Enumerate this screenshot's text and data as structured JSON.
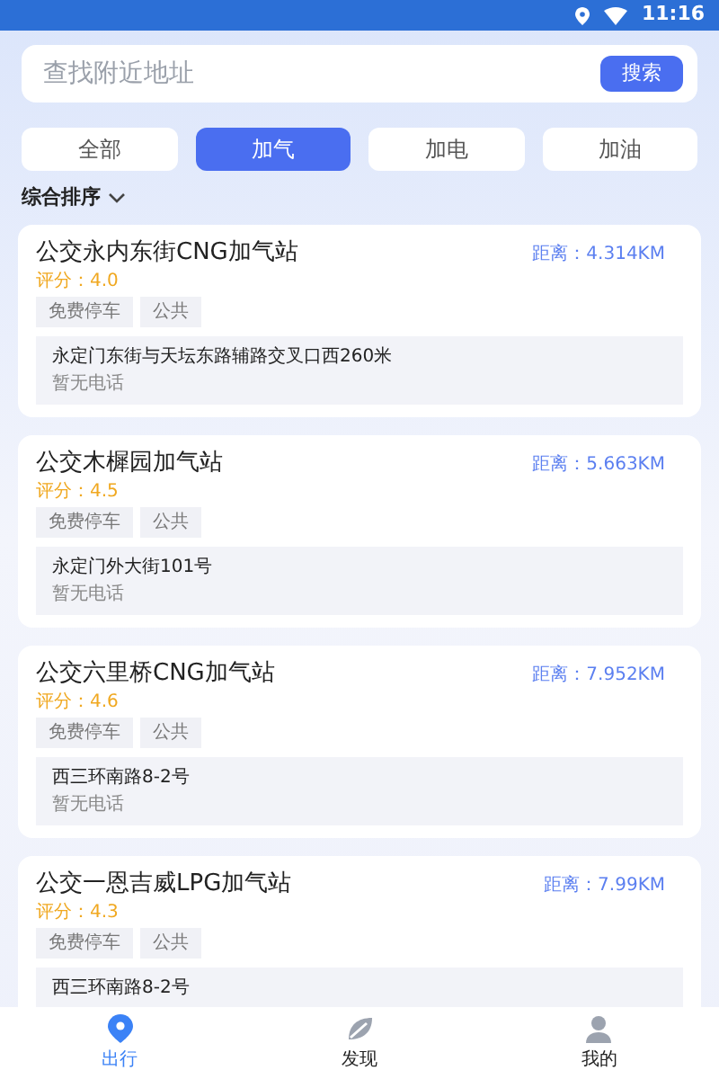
{
  "status_bar": {
    "time": "11:16"
  },
  "search": {
    "placeholder": "查找附近地址",
    "button": "搜索"
  },
  "tabs": [
    {
      "label": "全部",
      "selected": false
    },
    {
      "label": "加气",
      "selected": true
    },
    {
      "label": "加电",
      "selected": false
    },
    {
      "label": "加油",
      "selected": false
    }
  ],
  "sort": {
    "label": "综合排序"
  },
  "stations": [
    {
      "name": "公交永内东街CNG加气站",
      "distance": "距离：4.314KM",
      "rating": "评分：4.0",
      "tags": [
        "免费停车",
        "公共"
      ],
      "address": "永定门东街与天坛东路辅路交叉口西260米",
      "phone": "暂无电话"
    },
    {
      "name": "公交木樨园加气站",
      "distance": "距离：5.663KM",
      "rating": "评分：4.5",
      "tags": [
        "免费停车",
        "公共"
      ],
      "address": "永定门外大街101号",
      "phone": "暂无电话"
    },
    {
      "name": "公交六里桥CNG加气站",
      "distance": "距离：7.952KM",
      "rating": "评分：4.6",
      "tags": [
        "免费停车",
        "公共"
      ],
      "address": "西三环南路8-2号",
      "phone": "暂无电话"
    },
    {
      "name": "公交一恩吉威LPG加气站",
      "distance": "距离：7.99KM",
      "rating": "评分：4.3",
      "tags": [
        "免费停车",
        "公共"
      ],
      "address": "西三环南路8-2号"
    }
  ],
  "bottom_nav": [
    {
      "label": "出行",
      "kind": "pin",
      "selected": true
    },
    {
      "label": "发现",
      "kind": "discover",
      "selected": false
    },
    {
      "label": "我的",
      "kind": "user",
      "selected": false
    }
  ]
}
